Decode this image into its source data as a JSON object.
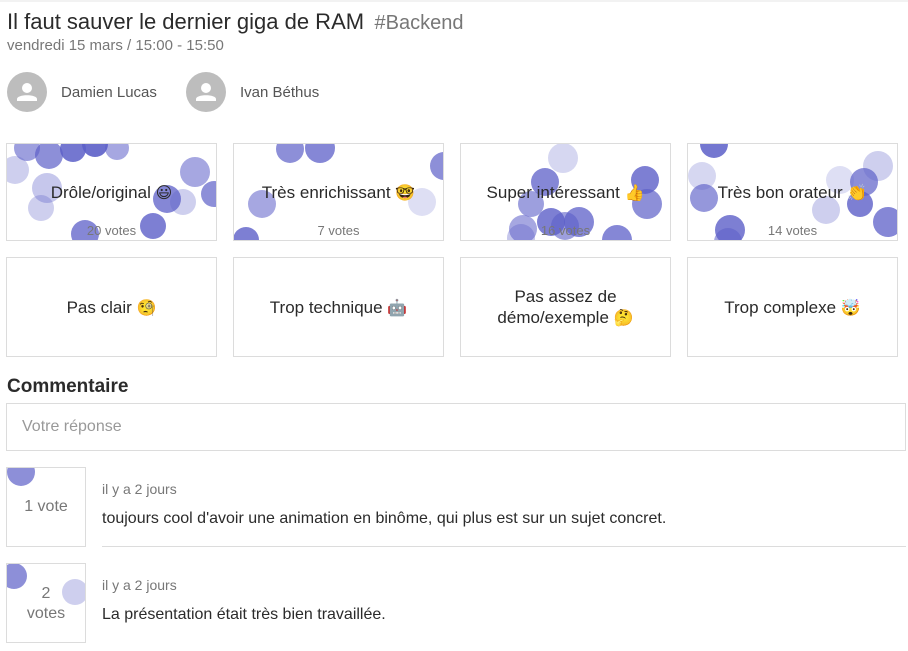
{
  "talk": {
    "title": "Il faut sauver le dernier giga de RAM",
    "tag": "#Backend",
    "datetime": "vendredi 15 mars / 15:00 - 15:50"
  },
  "speakers": [
    {
      "name": "Damien Lucas",
      "icon": "person-icon"
    },
    {
      "name": "Ivan Béthus",
      "icon": "person-icon"
    }
  ],
  "feedback": [
    {
      "label": "Drôle/original",
      "emoji": "😃",
      "votes": "20 votes"
    },
    {
      "label": "Très enrichissant",
      "emoji": "🤓",
      "votes": "7 votes"
    },
    {
      "label": "Super intéressant",
      "emoji": "👍",
      "votes": "16 votes"
    },
    {
      "label": "Très bon orateur",
      "emoji": "👏",
      "votes": "14 votes"
    },
    {
      "label": "Pas clair",
      "emoji": "🧐",
      "votes": ""
    },
    {
      "label": "Trop technique",
      "emoji": "🤖",
      "votes": ""
    },
    {
      "label": "Pas assez de",
      "label2": "démo/exemple",
      "emoji": "🤔",
      "votes": ""
    },
    {
      "label": "Trop complexe",
      "emoji": "🤯",
      "votes": ""
    }
  ],
  "comments_section": {
    "title": "Commentaire",
    "placeholder": "Votre réponse"
  },
  "comments": [
    {
      "votes": "1 vote",
      "time": "il y a 2 jours",
      "text": "toujours cool d'avoir une animation en binôme, qui plus est sur un sujet concret."
    },
    {
      "votes_num": "2",
      "votes_word": "votes",
      "time": "il y a 2 jours",
      "text": "La présentation était très bien travaillée."
    }
  ],
  "colors": {
    "bubble": "#5c5fc8",
    "border": "#dcdcdc",
    "avatar": "#bdbdbd"
  }
}
